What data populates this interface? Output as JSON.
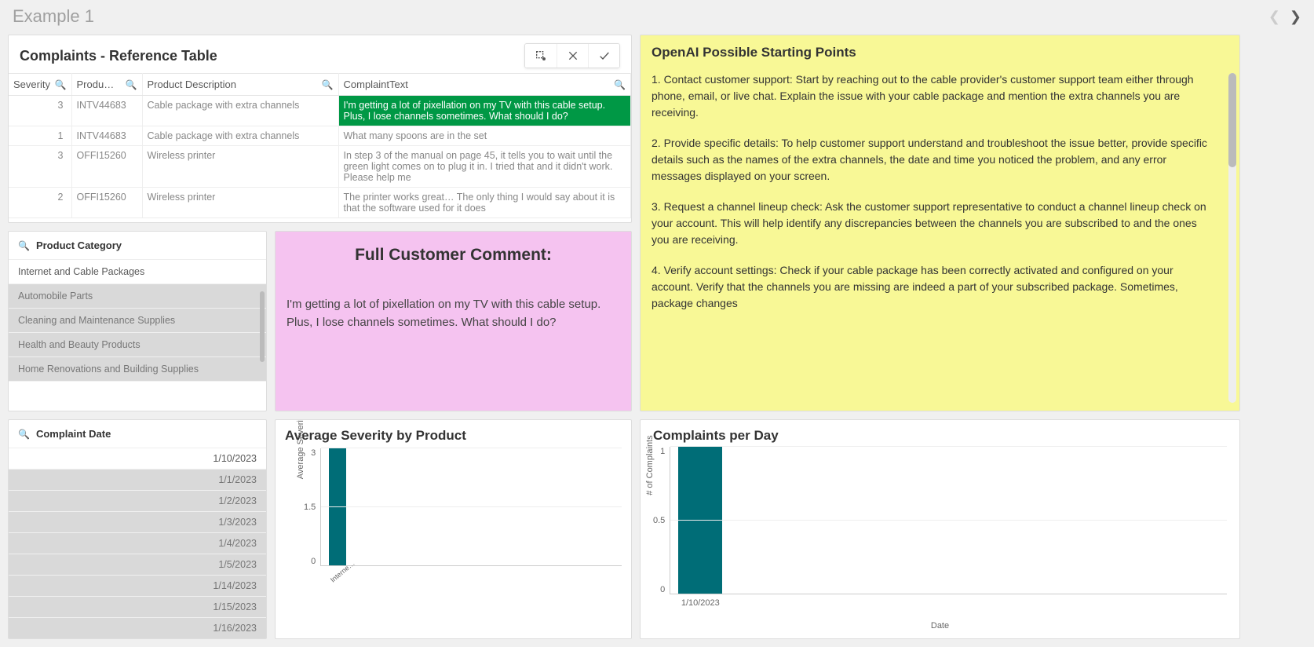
{
  "header": {
    "title": "Example 1"
  },
  "table": {
    "title": "Complaints - Reference Table",
    "columns": {
      "severity": "Severity",
      "product": "Produ…",
      "description": "Product Description",
      "complaint": "ComplaintText"
    },
    "rows": [
      {
        "severity": "3",
        "product": "INTV44683",
        "description": "Cable package with extra channels",
        "complaint": "I'm getting a lot of pixellation on my TV with this cable setup. Plus, I lose channels sometimes. What should I do?",
        "selected": true
      },
      {
        "severity": "1",
        "product": "INTV44683",
        "description": "Cable package with extra channels",
        "complaint": "What many spoons are in the set"
      },
      {
        "severity": "3",
        "product": "OFFI15260",
        "description": "Wireless printer",
        "complaint": "In step 3 of the manual on page 45, it tells you to wait until the green light comes on to plug it in. I tried that and it didn't work. Please help me"
      },
      {
        "severity": "2",
        "product": "OFFI15260",
        "description": "Wireless printer",
        "complaint": "The printer works great… The only thing I would say about it is that the software used for it does"
      }
    ]
  },
  "category": {
    "title": "Product Category",
    "items": [
      {
        "label": "Internet and Cable Packages",
        "dim": false
      },
      {
        "label": "Automobile Parts",
        "dim": true
      },
      {
        "label": "Cleaning and Maintenance Supplies",
        "dim": true
      },
      {
        "label": "Health and Beauty Products",
        "dim": true
      },
      {
        "label": "Home Renovations and Building Supplies",
        "dim": true
      }
    ]
  },
  "dates": {
    "title": "Complaint Date",
    "items": [
      {
        "label": "1/10/2023",
        "dim": false
      },
      {
        "label": "1/1/2023",
        "dim": true
      },
      {
        "label": "1/2/2023",
        "dim": true
      },
      {
        "label": "1/3/2023",
        "dim": true
      },
      {
        "label": "1/4/2023",
        "dim": true
      },
      {
        "label": "1/5/2023",
        "dim": true
      },
      {
        "label": "1/14/2023",
        "dim": true
      },
      {
        "label": "1/15/2023",
        "dim": true
      },
      {
        "label": "1/16/2023",
        "dim": true
      }
    ]
  },
  "comment": {
    "title": "Full Customer Comment:",
    "body": "I'm getting a lot of pixellation on my TV with this cable setup. Plus, I lose channels sometimes. What should I do?"
  },
  "ai": {
    "title": "OpenAI Possible Starting Points",
    "paragraphs": [
      "1. Contact customer support: Start by reaching out to the cable provider's customer support team either through phone, email, or live chat. Explain the issue with your cable package and mention the extra channels you are receiving.",
      "2. Provide specific details: To help customer support understand and troubleshoot the issue better, provide specific details such as the names of the extra channels, the date and time you noticed the problem, and any error messages displayed on your screen.",
      "3. Request a channel lineup check: Ask the customer support representative to conduct a channel lineup check on your account. This will help identify any discrepancies between the channels you are subscribed to and the ones you are receiving.",
      "4. Verify account settings: Check if your cable package has been correctly activated and configured on your account. Verify that the channels you are missing are indeed a part of your subscribed package. Sometimes, package changes"
    ]
  },
  "sevChart": {
    "title": "Average Severity by Product"
  },
  "cpdChart": {
    "title": "Complaints per Day"
  },
  "chart_data": [
    {
      "type": "bar",
      "title": "Average Severity by Product",
      "ylabel": "Average Severity",
      "xlabel": "",
      "categories": [
        "Interne…"
      ],
      "values": [
        3
      ],
      "ylim": [
        0,
        3
      ],
      "yticks": [
        0,
        1.5,
        3
      ]
    },
    {
      "type": "bar",
      "title": "Complaints per Day",
      "ylabel": "# of Complaints",
      "xlabel": "Date",
      "categories": [
        "1/10/2023"
      ],
      "values": [
        1
      ],
      "ylim": [
        0,
        1
      ],
      "yticks": [
        0,
        0.5,
        1
      ]
    }
  ]
}
